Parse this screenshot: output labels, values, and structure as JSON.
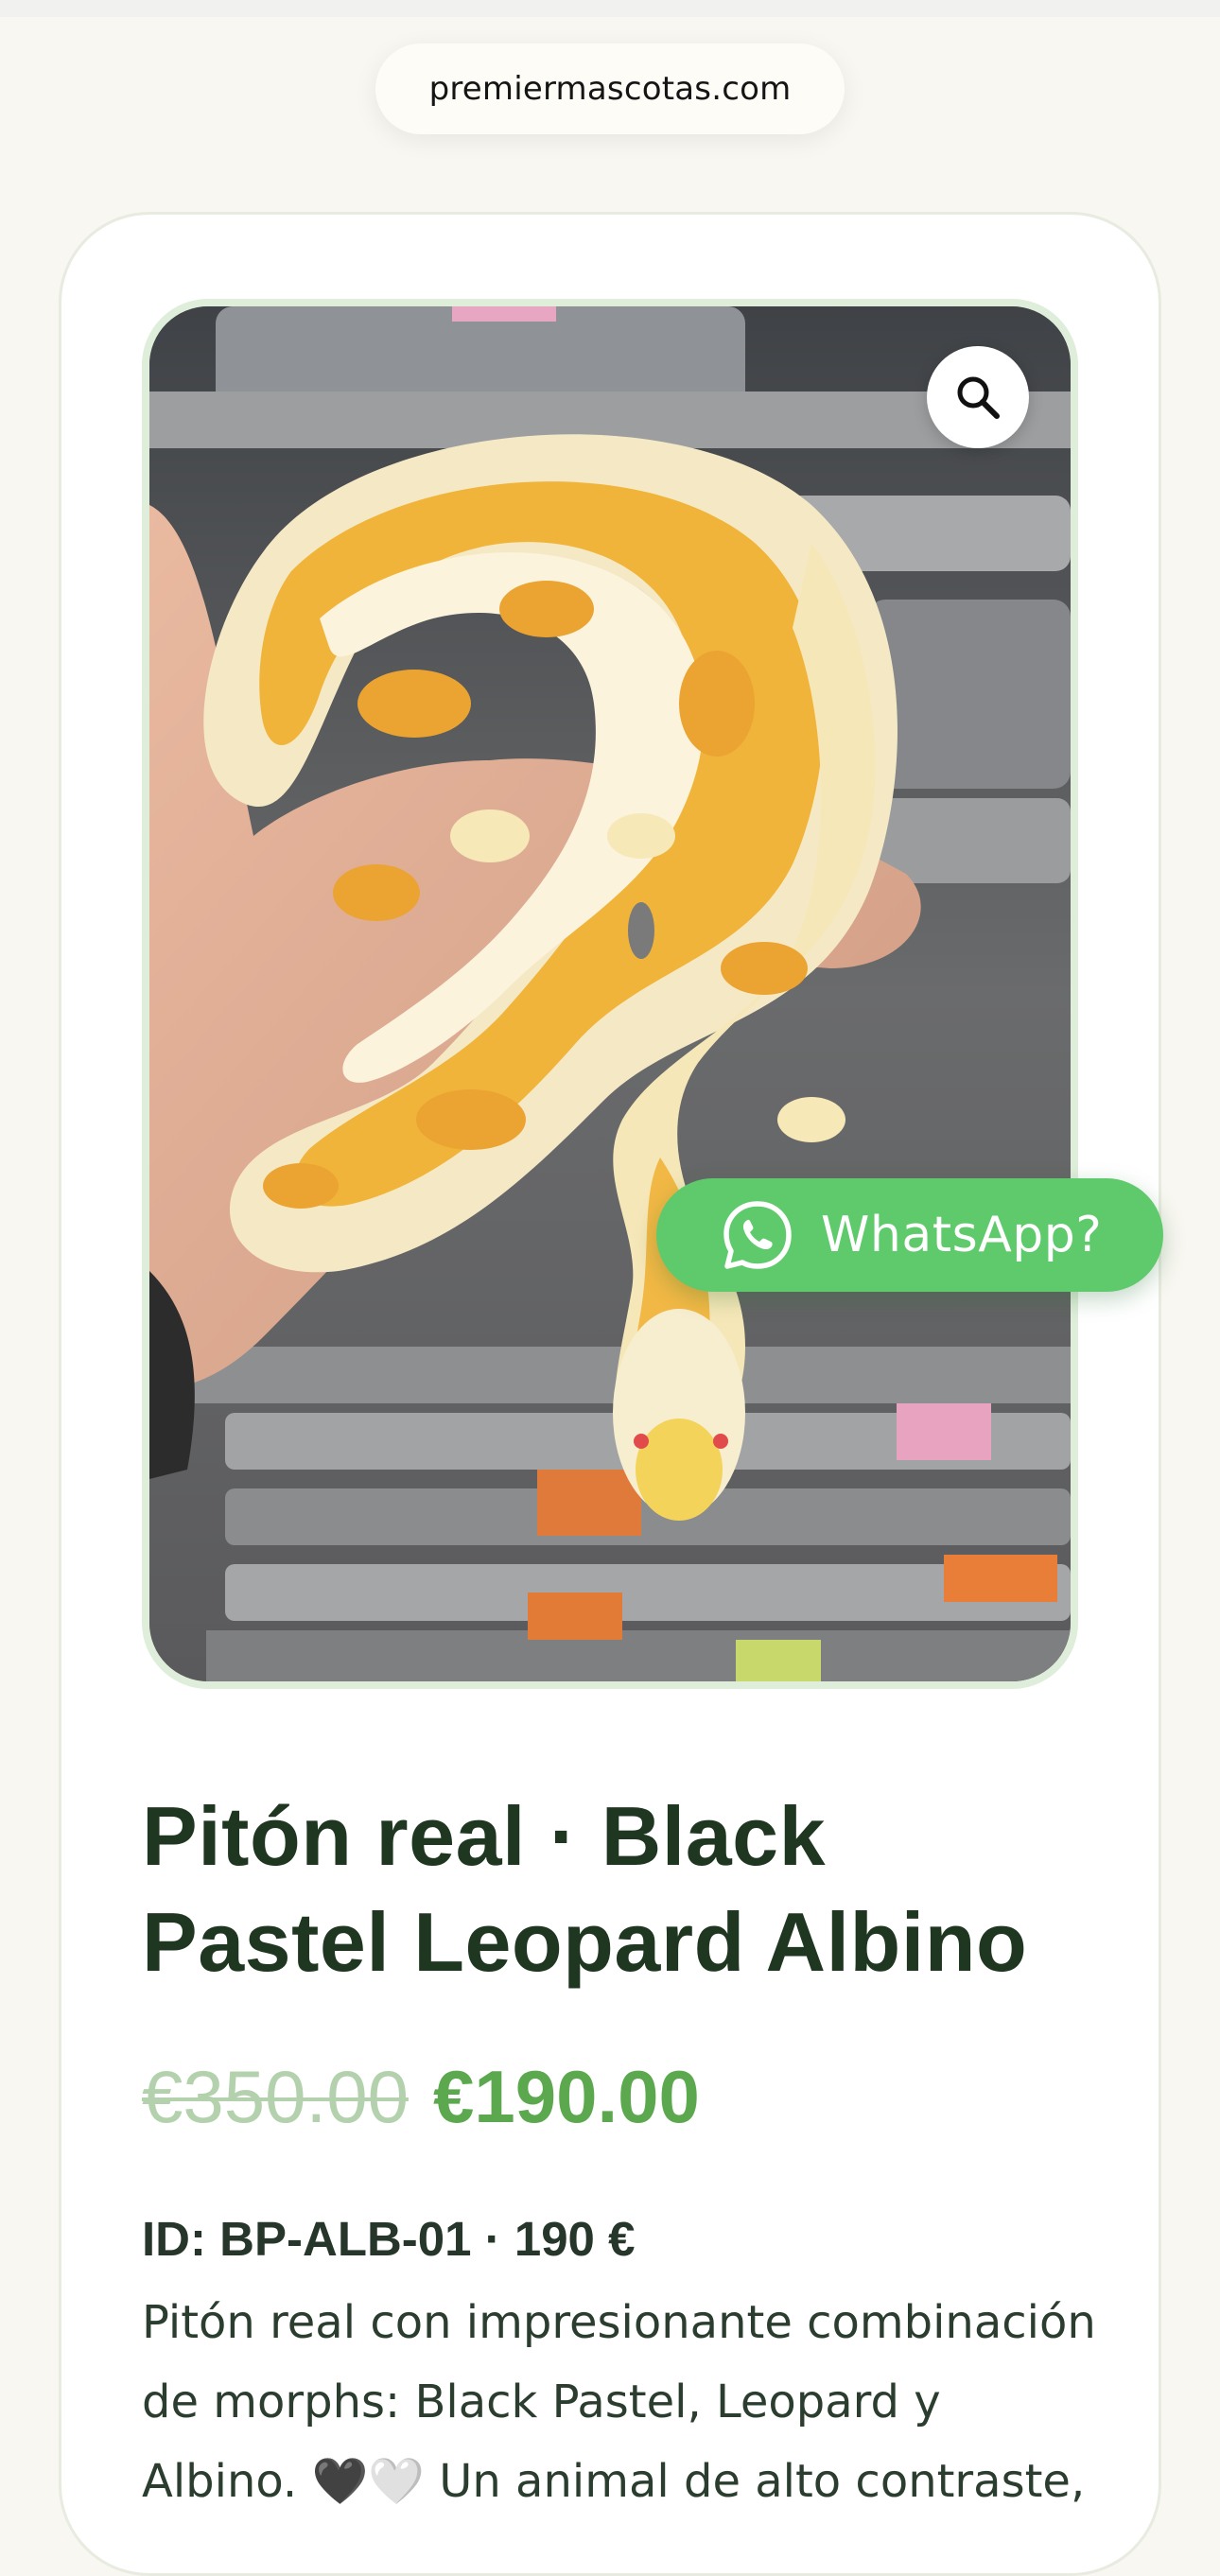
{
  "browser": {
    "url": "premiermascotas.com"
  },
  "product": {
    "image_alt": "Pitón real albino enroscada en una mano",
    "title": "Pitón real · Black Pastel Leopard Albino",
    "price_old": "€350.00",
    "price_new": "€190.00",
    "id_line": "ID: BP-ALB-01 · 190 €",
    "description_part1": "Pitón real con impresionante combinación de morphs: Black Pastel, Leopard y Albino. ",
    "heart_black": "🖤",
    "heart_white": "🤍",
    "description_part2": " Un animal de alto contraste,"
  },
  "whatsapp": {
    "label": "WhatsApp?",
    "icon": "whatsapp-icon"
  },
  "zoom": {
    "icon": "search-icon"
  },
  "colors": {
    "accent_green": "#5ca84e",
    "whatsapp_green": "#5fca6c",
    "title_dark_green": "#1f3621",
    "old_price": "#b4d1ad",
    "page_bg": "#f8f7f1"
  }
}
